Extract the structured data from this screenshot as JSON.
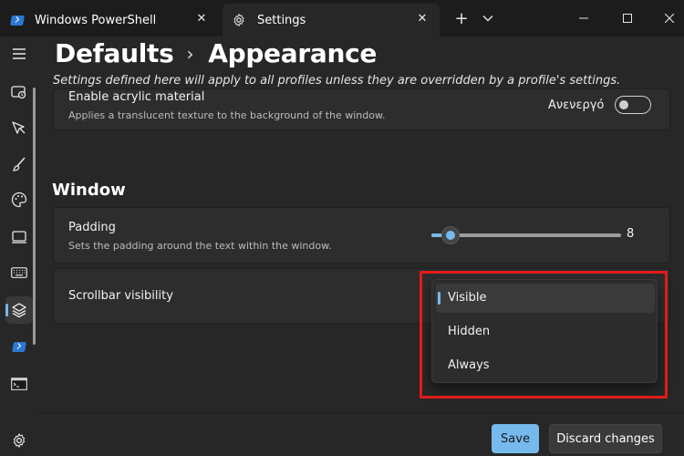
{
  "tabs": [
    {
      "label": "Windows PowerShell",
      "icon": "powershell-icon"
    },
    {
      "label": "Settings",
      "icon": "gear-icon",
      "active": true
    }
  ],
  "titlebar": {
    "new_tab": "+",
    "dropdown": "chevron-down-icon",
    "minimize": "minimize-icon",
    "maximize": "maximize-icon",
    "close": "close-icon"
  },
  "nav": {
    "items": [
      "menu-icon",
      "startup-icon",
      "interaction-icon",
      "appearance-icon",
      "color-schemes-icon",
      "rendering-icon",
      "actions-icon",
      "defaults-icon",
      "powershell-profile-icon",
      "command-prompt-icon"
    ],
    "selected_index": 7,
    "settings_icon": "gear-icon"
  },
  "header": {
    "crumb1": "Defaults",
    "separator": "›",
    "crumb2": "Appearance",
    "subtitle": "Settings defined here will apply to all profiles unless they are overridden by a profile's settings."
  },
  "acrylic": {
    "title": "Enable acrylic material",
    "description": "Applies a translucent texture to the background of the window.",
    "toggle_label": "Ανενεργό",
    "toggle_on": false
  },
  "window_section": {
    "title": "Window",
    "padding": {
      "title": "Padding",
      "description": "Sets the padding around the text within the window.",
      "value": "8",
      "slider_fraction": 0.1
    },
    "scrollbar": {
      "title": "Scrollbar visibility",
      "options": [
        "Visible",
        "Hidden",
        "Always"
      ],
      "selected": "Visible"
    }
  },
  "footer": {
    "save": "Save",
    "discard": "Discard changes"
  },
  "colors": {
    "accent": "#76b9ed",
    "highlight": "#e21b1b",
    "background": "#272727"
  }
}
